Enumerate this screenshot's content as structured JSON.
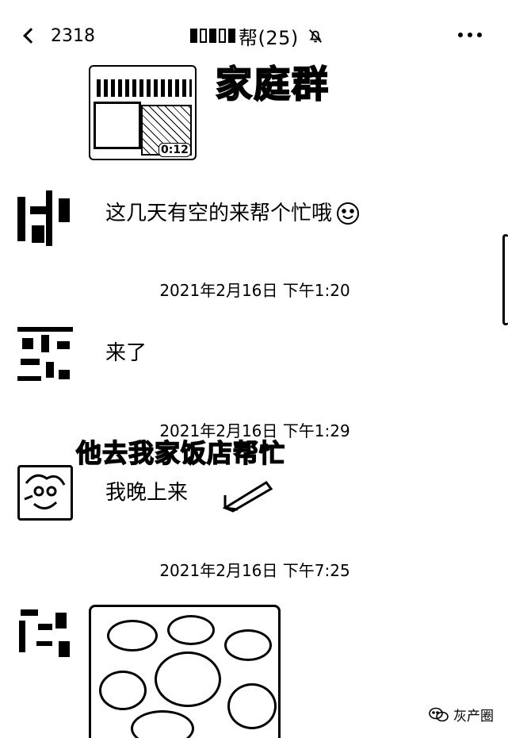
{
  "header": {
    "back_count": "2318",
    "group_title": "帮(25)"
  },
  "annotations": {
    "family_group": "家庭群",
    "helper_note": "他去我家饭店帮忙"
  },
  "image_badge": "0:12",
  "messages": [
    {
      "text": "这几天有空的来帮个忙哦"
    },
    {
      "text": "来了"
    },
    {
      "text": "我晚上来"
    }
  ],
  "timestamps": [
    "2021年2月16日 下午1:20",
    "2021年2月16日 下午1:29",
    "2021年2月16日 下午7:25"
  ],
  "watermark": "灰产圈",
  "icons": {
    "back": "chevron-left-icon",
    "mute": "bell-slash-icon",
    "more": "more-dots-icon",
    "emoji": "smile-emoji-icon",
    "arrow": "hand-drawn-arrow-icon",
    "watermark": "wechat-icon"
  }
}
